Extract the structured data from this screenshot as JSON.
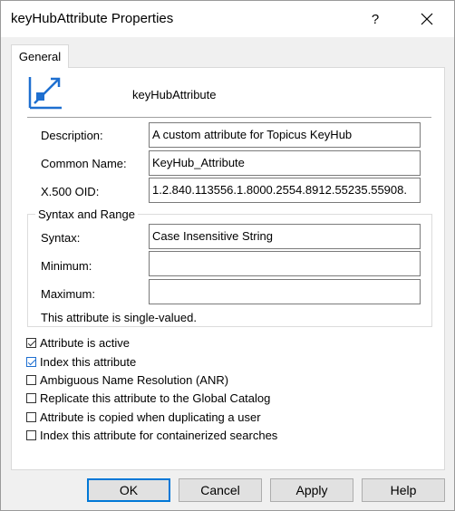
{
  "window": {
    "title": "keyHubAttribute Properties",
    "help_glyph": "?",
    "close_glyph": "✕"
  },
  "tabs": [
    {
      "label": "General",
      "selected": true
    }
  ],
  "header": {
    "attribute_name": "keyHubAttribute",
    "icon": "attribute-icon"
  },
  "fields": {
    "description": {
      "label": "Description:",
      "value": "A custom attribute for Topicus KeyHub"
    },
    "common_name": {
      "label": "Common Name:",
      "value": "KeyHub_Attribute"
    },
    "oid": {
      "label": "X.500 OID:",
      "value": "1.2.840.113556.1.8000.2554.8912.55235.55908."
    }
  },
  "syntax_group": {
    "title": "Syntax and Range",
    "syntax": {
      "label": "Syntax:",
      "value": "Case Insensitive String"
    },
    "minimum": {
      "label": "Minimum:",
      "value": ""
    },
    "maximum": {
      "label": "Maximum:",
      "value": ""
    },
    "note": "This attribute is single-valued."
  },
  "checkboxes": [
    {
      "label": "Attribute is active",
      "checked": true
    },
    {
      "label": "Index this attribute",
      "checked": true
    },
    {
      "label": "Ambiguous Name Resolution (ANR)",
      "checked": false
    },
    {
      "label": "Replicate this attribute to the Global Catalog",
      "checked": false
    },
    {
      "label": "Attribute is copied when duplicating a user",
      "checked": false
    },
    {
      "label": "Index this attribute for containerized searches",
      "checked": false
    }
  ],
  "buttons": {
    "ok": "OK",
    "cancel": "Cancel",
    "apply": "Apply",
    "help": "Help"
  },
  "colors": {
    "accent": "#0078d7",
    "icon_blue": "#1e6fd0"
  }
}
